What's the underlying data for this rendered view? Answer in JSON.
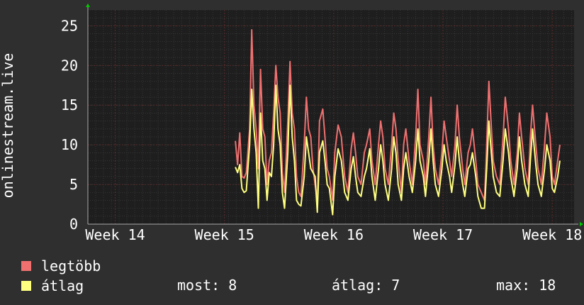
{
  "chart_data": {
    "type": "line",
    "ylabel": "onlinestream.live",
    "ylim": [
      0,
      27
    ],
    "y_ticks": [
      0,
      5,
      10,
      15,
      20,
      25
    ],
    "x_tick_labels": [
      "Week 14",
      "Week 15",
      "Week 16",
      "Week 17",
      "Week 18"
    ],
    "x_domain_weeks": [
      13.75,
      18.2
    ],
    "grid": true,
    "series": [
      {
        "name": "legtöbb",
        "color": "#f07070",
        "points": [
          [
            15.1,
            10.5
          ],
          [
            15.12,
            7.5
          ],
          [
            15.14,
            11.5
          ],
          [
            15.16,
            6
          ],
          [
            15.18,
            5.8
          ],
          [
            15.2,
            6.5
          ],
          [
            15.23,
            12
          ],
          [
            15.25,
            24.5
          ],
          [
            15.27,
            15
          ],
          [
            15.29,
            12
          ],
          [
            15.31,
            7
          ],
          [
            15.33,
            19.5
          ],
          [
            15.35,
            12
          ],
          [
            15.37,
            11
          ],
          [
            15.39,
            5
          ],
          [
            15.41,
            8
          ],
          [
            15.43,
            9
          ],
          [
            15.45,
            14
          ],
          [
            15.47,
            20
          ],
          [
            15.49,
            16
          ],
          [
            15.51,
            14
          ],
          [
            15.53,
            6.5
          ],
          [
            15.55,
            4
          ],
          [
            15.58,
            13
          ],
          [
            15.6,
            20.5
          ],
          [
            15.62,
            14
          ],
          [
            15.64,
            12
          ],
          [
            15.66,
            6
          ],
          [
            15.68,
            4
          ],
          [
            15.7,
            3.5
          ],
          [
            15.73,
            10
          ],
          [
            15.75,
            16
          ],
          [
            15.77,
            12
          ],
          [
            15.79,
            11
          ],
          [
            15.81,
            7
          ],
          [
            15.83,
            5
          ],
          [
            15.85,
            3
          ],
          [
            15.87,
            13
          ],
          [
            15.9,
            14.5
          ],
          [
            15.92,
            11
          ],
          [
            15.94,
            7
          ],
          [
            15.96,
            6
          ],
          [
            15.99,
            3
          ],
          [
            16.01,
            9
          ],
          [
            16.04,
            12.5
          ],
          [
            16.07,
            11
          ],
          [
            16.1,
            6
          ],
          [
            16.13,
            4
          ],
          [
            16.16,
            9.5
          ],
          [
            16.18,
            11.5
          ],
          [
            16.2,
            9
          ],
          [
            16.22,
            6
          ],
          [
            16.25,
            5
          ],
          [
            16.28,
            9
          ],
          [
            16.3,
            10
          ],
          [
            16.33,
            12
          ],
          [
            16.35,
            8
          ],
          [
            16.38,
            5
          ],
          [
            16.41,
            10
          ],
          [
            16.43,
            13
          ],
          [
            16.45,
            11
          ],
          [
            16.47,
            7
          ],
          [
            16.5,
            5
          ],
          [
            16.53,
            10
          ],
          [
            16.55,
            14
          ],
          [
            16.57,
            12
          ],
          [
            16.59,
            8
          ],
          [
            16.62,
            4
          ],
          [
            16.64,
            10
          ],
          [
            16.66,
            12
          ],
          [
            16.69,
            8
          ],
          [
            16.72,
            5
          ],
          [
            16.75,
            11
          ],
          [
            16.77,
            17
          ],
          [
            16.79,
            10
          ],
          [
            16.82,
            8
          ],
          [
            16.84,
            5
          ],
          [
            16.87,
            11
          ],
          [
            16.89,
            16
          ],
          [
            16.91,
            10
          ],
          [
            16.93,
            7
          ],
          [
            16.96,
            5
          ],
          [
            16.99,
            9
          ],
          [
            17.01,
            13
          ],
          [
            17.03,
            11
          ],
          [
            17.06,
            8
          ],
          [
            17.08,
            6
          ],
          [
            17.11,
            10
          ],
          [
            17.13,
            15
          ],
          [
            17.15,
            11
          ],
          [
            17.18,
            7
          ],
          [
            17.2,
            5
          ],
          [
            17.23,
            9
          ],
          [
            17.25,
            10
          ],
          [
            17.27,
            12
          ],
          [
            17.3,
            8
          ],
          [
            17.32,
            5
          ],
          [
            17.35,
            4
          ],
          [
            17.38,
            3
          ],
          [
            17.4,
            10
          ],
          [
            17.42,
            18
          ],
          [
            17.44,
            13
          ],
          [
            17.46,
            8
          ],
          [
            17.49,
            6
          ],
          [
            17.52,
            5
          ],
          [
            17.55,
            11
          ],
          [
            17.57,
            16
          ],
          [
            17.6,
            12
          ],
          [
            17.62,
            8
          ],
          [
            17.65,
            5
          ],
          [
            17.68,
            9
          ],
          [
            17.7,
            14
          ],
          [
            17.72,
            11
          ],
          [
            17.75,
            7
          ],
          [
            17.78,
            5
          ],
          [
            17.8,
            11
          ],
          [
            17.82,
            15
          ],
          [
            17.85,
            10
          ],
          [
            17.87,
            7
          ],
          [
            17.9,
            5
          ],
          [
            17.93,
            10
          ],
          [
            17.95,
            14
          ],
          [
            17.98,
            11
          ],
          [
            18.0,
            6
          ],
          [
            18.02,
            5
          ],
          [
            18.05,
            8
          ],
          [
            18.07,
            10
          ]
        ]
      },
      {
        "name": "átlag",
        "color": "#ffff80",
        "points": [
          [
            15.1,
            7.2
          ],
          [
            15.12,
            6.5
          ],
          [
            15.14,
            7.5
          ],
          [
            15.16,
            4.5
          ],
          [
            15.18,
            4
          ],
          [
            15.2,
            4.2
          ],
          [
            15.23,
            10
          ],
          [
            15.25,
            17
          ],
          [
            15.27,
            12
          ],
          [
            15.29,
            9
          ],
          [
            15.31,
            2
          ],
          [
            15.33,
            14
          ],
          [
            15.35,
            8
          ],
          [
            15.37,
            7
          ],
          [
            15.39,
            3
          ],
          [
            15.41,
            6.5
          ],
          [
            15.43,
            6
          ],
          [
            15.45,
            10
          ],
          [
            15.47,
            17.5
          ],
          [
            15.49,
            12
          ],
          [
            15.51,
            10
          ],
          [
            15.53,
            4
          ],
          [
            15.55,
            2
          ],
          [
            15.58,
            9
          ],
          [
            15.6,
            17.5
          ],
          [
            15.62,
            11
          ],
          [
            15.64,
            8
          ],
          [
            15.66,
            3
          ],
          [
            15.68,
            2.5
          ],
          [
            15.7,
            2.3
          ],
          [
            15.73,
            6
          ],
          [
            15.75,
            11
          ],
          [
            15.77,
            9
          ],
          [
            15.79,
            7
          ],
          [
            15.81,
            6.5
          ],
          [
            15.83,
            6
          ],
          [
            15.85,
            1.5
          ],
          [
            15.87,
            9
          ],
          [
            15.9,
            10.5
          ],
          [
            15.92,
            8
          ],
          [
            15.94,
            5
          ],
          [
            15.96,
            4.5
          ],
          [
            15.99,
            1.2
          ],
          [
            16.01,
            6
          ],
          [
            16.04,
            9.5
          ],
          [
            16.07,
            8
          ],
          [
            16.1,
            4
          ],
          [
            16.13,
            3
          ],
          [
            16.16,
            7
          ],
          [
            16.18,
            8.5
          ],
          [
            16.2,
            6
          ],
          [
            16.22,
            4
          ],
          [
            16.25,
            3.5
          ],
          [
            16.28,
            6
          ],
          [
            16.3,
            7
          ],
          [
            16.33,
            9.5
          ],
          [
            16.35,
            6
          ],
          [
            16.38,
            3
          ],
          [
            16.41,
            7
          ],
          [
            16.43,
            10
          ],
          [
            16.45,
            8
          ],
          [
            16.47,
            5
          ],
          [
            16.5,
            3
          ],
          [
            16.53,
            7
          ],
          [
            16.55,
            11
          ],
          [
            16.57,
            9
          ],
          [
            16.59,
            5
          ],
          [
            16.62,
            3
          ],
          [
            16.64,
            7
          ],
          [
            16.66,
            9
          ],
          [
            16.69,
            6
          ],
          [
            16.72,
            4
          ],
          [
            16.75,
            8
          ],
          [
            16.77,
            12
          ],
          [
            16.79,
            8
          ],
          [
            16.82,
            6
          ],
          [
            16.84,
            3.5
          ],
          [
            16.87,
            8
          ],
          [
            16.89,
            12
          ],
          [
            16.91,
            8
          ],
          [
            16.93,
            5
          ],
          [
            16.96,
            3.5
          ],
          [
            16.99,
            7
          ],
          [
            17.01,
            10
          ],
          [
            17.03,
            8
          ],
          [
            17.06,
            6
          ],
          [
            17.08,
            4
          ],
          [
            17.11,
            7.5
          ],
          [
            17.13,
            11
          ],
          [
            17.15,
            8
          ],
          [
            17.18,
            5
          ],
          [
            17.2,
            3.5
          ],
          [
            17.23,
            7
          ],
          [
            17.25,
            7.5
          ],
          [
            17.27,
            9
          ],
          [
            17.3,
            6
          ],
          [
            17.32,
            3.5
          ],
          [
            17.35,
            2
          ],
          [
            17.38,
            2
          ],
          [
            17.4,
            7
          ],
          [
            17.42,
            13
          ],
          [
            17.44,
            9.5
          ],
          [
            17.46,
            6
          ],
          [
            17.49,
            4
          ],
          [
            17.52,
            3.5
          ],
          [
            17.55,
            8
          ],
          [
            17.57,
            12
          ],
          [
            17.6,
            9
          ],
          [
            17.62,
            6
          ],
          [
            17.65,
            3.5
          ],
          [
            17.68,
            7
          ],
          [
            17.7,
            11
          ],
          [
            17.72,
            8
          ],
          [
            17.75,
            5
          ],
          [
            17.78,
            3.5
          ],
          [
            17.8,
            8
          ],
          [
            17.82,
            12
          ],
          [
            17.85,
            7.5
          ],
          [
            17.87,
            5
          ],
          [
            17.9,
            3.5
          ],
          [
            17.93,
            7
          ],
          [
            17.95,
            10
          ],
          [
            17.98,
            8
          ],
          [
            18.0,
            4.5
          ],
          [
            18.02,
            4
          ],
          [
            18.05,
            6
          ],
          [
            18.07,
            8
          ]
        ]
      }
    ]
  },
  "legend": {
    "max_label": "legtöbb",
    "avg_label": "átlag"
  },
  "stats": {
    "now": "most: 8",
    "avg": "átlag: 7",
    "max": "max: 18"
  },
  "colors": {
    "background": "#2f2f2f",
    "plot_bg": "#1e1e1e",
    "grid": "#454545",
    "week_line": "#5a2a2a",
    "text": "#ffffff",
    "axis_arrow": "#00cc00"
  }
}
